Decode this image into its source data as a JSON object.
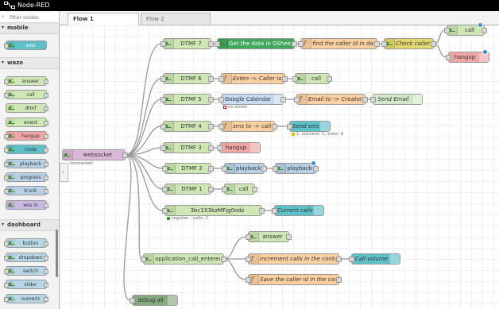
{
  "header": {
    "title": "Node-RED"
  },
  "palette": {
    "filter_placeholder": "filter nodes",
    "categories": [
      {
        "name": "mobile",
        "items": [
          "sms"
        ]
      },
      {
        "name": "wazo",
        "items": [
          "answer",
          "call",
          "dtmf",
          "event",
          "hangup",
          "node",
          "playback",
          "progress",
          "trunk",
          "wss in"
        ]
      },
      {
        "name": "dashboard",
        "items": [
          "button",
          "dropdown",
          "switch",
          "slider",
          "numeric"
        ]
      }
    ]
  },
  "tabs": [
    {
      "label": "Flow 1",
      "active": true
    },
    {
      "label": "Flow 2",
      "active": false
    }
  ],
  "flow": {
    "websocket": {
      "label": "websocket",
      "status": "connected"
    },
    "dtmf7": "DTMF 7",
    "gsheet": "Get the data in GSheet",
    "find_caller": "find the caller id in data",
    "check_caller": "Check caller",
    "call_top": "call",
    "hangup_top": "hangup",
    "dtmf6": "DTMF 6",
    "exten_caller": "Exten -> Caller id",
    "call6": "call",
    "dtmf5": "DTMF 5",
    "gcal": {
      "label": "Google Calendar",
      "status": "no event"
    },
    "email_creator": "Email to -> Creator",
    "send_email": "Send Email",
    "dtmf4": "DTMF 4",
    "sms_caller": "sms to -> caller",
    "send_sms": {
      "label": "Send sms",
      "status": "1, success: 1, error: 0"
    },
    "dtmf3": "DTMF 3",
    "hangup3": "hangup",
    "dtmf2": "DTMF 2",
    "playback_a": "playback",
    "playback_b": "playback",
    "dtmf1": "DTMF 1",
    "call1": "call",
    "register": {
      "label": "3bc1X3bzMFjg0odz",
      "status": "register - calls: 1"
    },
    "current_calls": "Current calls",
    "app_entered": "application_call_entered",
    "answer": "answer",
    "increment": "Increment calls in the context",
    "call_volume": "Call volume",
    "save_caller": "Save the caller id in the context",
    "debug_all": "debug all"
  },
  "colors": {
    "wazo": "#a6bbcf",
    "wazo_green": "#cfe6b5",
    "function": "#fdd0a2",
    "gsheet": "#3fa85b",
    "switch": "#e2d96e",
    "hangup": "#f2a5a5",
    "dashboard": "#b8d7e6",
    "debug": "#87a980",
    "email": "#d4e9c7"
  }
}
